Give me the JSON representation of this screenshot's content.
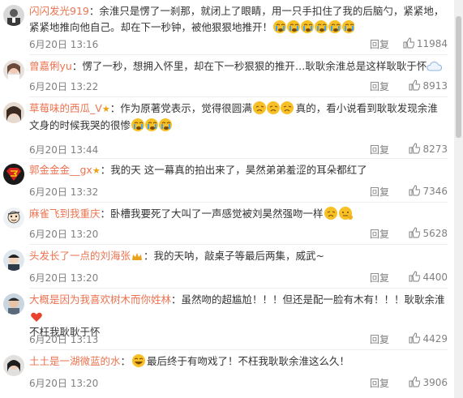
{
  "comments": [
    {
      "user": "闪闪发光919",
      "text": "：余淮只是愣了一刹那，就闭上了眼睛，用一只手扣住了我的后脑勺，紧紧地，紧紧地推向他自己。却在下一秒钟，被他狠狠地推开！",
      "time": "6月20日 13:16",
      "reply": "回复",
      "likes": "11984"
    },
    {
      "user": "曾嘉俐yu",
      "text": "：愣了一秒，想拥入怀里，却在下一秒狠狠的推开…耿耿余淮总是这样耿耿于怀",
      "time": "6月20日 13:22",
      "reply": "回复",
      "likes": "8913"
    },
    {
      "user": "草莓味的西瓜_V",
      "text_a": "：作为原著党表示，觉得很圆满",
      "text_b": "真的，看小说看到耿耿发现余淮文身的时候我哭的很惨",
      "time": "6月20日 13:44",
      "reply": "回复",
      "likes": "8273"
    },
    {
      "user": "郭金金金__gx",
      "text": "：我的天 这一幕真的拍出来了，昊然弟弟羞涩的耳朵都红了",
      "time": "6月20日 13:32",
      "reply": "回复",
      "likes": "7346"
    },
    {
      "user": "麻雀飞到我重庆",
      "text": "：卧槽我要死了大叫了一声感觉被刘昊然强吻一样",
      "time": "6月20日 13:20",
      "reply": "回复",
      "likes": "5628"
    },
    {
      "user": "头发长了一点的刘海张",
      "text": "：我的天呐，敲桌子等最后两集，威武~",
      "time": "6月20日 13:20",
      "reply": "回复",
      "likes": "4400"
    },
    {
      "user": "大概是因为我喜欢树木而你姓林",
      "text": "：虽然吻的超尴尬！！！但还是配一脸有木有！！！耿耿余淮",
      "text2": "不枉我耿耿于怀",
      "time": "6月20日 13:13",
      "reply": "回复",
      "likes": "4429"
    },
    {
      "user": "土土是一湖微蓝的水",
      "text": "最后终于有吻戏了！不枉我耿耿余淮这么久！",
      "time": "6月20日 13:20",
      "reply": "回复",
      "likes": "3906"
    }
  ],
  "colors": {
    "username": "#eb7350",
    "meta": "#808080",
    "text": "#333333",
    "heart": "#e8432f"
  },
  "icons": [
    "thumbs-up-icon",
    "crying-face-icon",
    "weary-face-icon",
    "cloud-icon",
    "crown-icon",
    "heart-icon",
    "laughing-face-icon"
  ]
}
